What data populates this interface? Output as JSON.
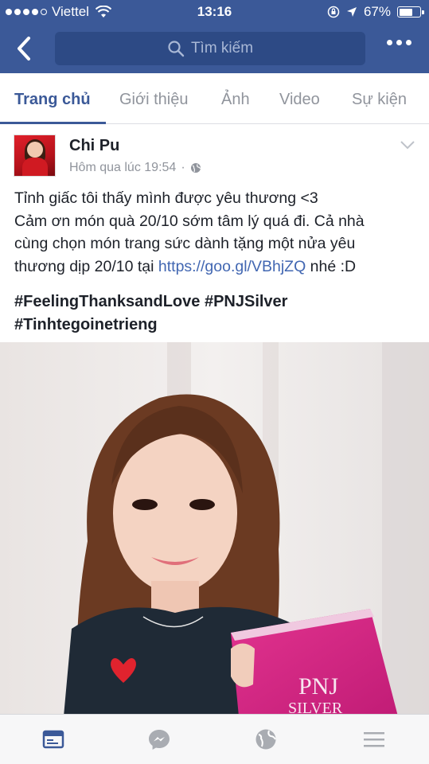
{
  "status_bar": {
    "carrier": "Viettel",
    "time": "13:16",
    "battery_percent": "67%",
    "battery_level": 0.67
  },
  "nav": {
    "search_placeholder": "Tìm kiếm"
  },
  "tabs": [
    {
      "label": "Trang chủ",
      "active": true
    },
    {
      "label": "Giới thiệu",
      "active": false
    },
    {
      "label": "Ảnh",
      "active": false
    },
    {
      "label": "Video",
      "active": false
    },
    {
      "label": "Sự kiện",
      "active": false
    }
  ],
  "post": {
    "author": "Chi Pu",
    "timestamp": "Hôm qua lúc 19:54",
    "lines": [
      "Tỉnh giấc tôi thấy mình được yêu thương <3",
      "Cảm ơn món quà 20/10 sớm tâm lý quá đi. Cả nhà",
      "cùng chọn món trang sức dành tặng một nửa yêu"
    ],
    "line4_prefix": "thương dịp 20/10 tại ",
    "link": "https://goo.gl/VBhjZQ",
    "line4_suffix": " nhé :D",
    "hashtags": [
      "#FeelingThanksandLove #PNJSilver",
      "#Tinhtegoinetrieng"
    ],
    "photo_box_text": [
      "PNJ",
      "SILVER"
    ]
  },
  "colors": {
    "brand": "#3b5998",
    "link": "#4267b2",
    "muted": "#90949c"
  },
  "bottom_tabs": [
    {
      "icon": "news-feed-icon",
      "active": true
    },
    {
      "icon": "messenger-icon",
      "active": false
    },
    {
      "icon": "globe-icon",
      "active": false
    },
    {
      "icon": "menu-icon",
      "active": false
    }
  ]
}
